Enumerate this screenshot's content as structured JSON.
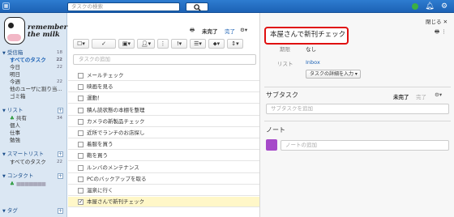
{
  "topbar": {
    "menu_icon": "grid-icon",
    "search_placeholder": "タスクの検索",
    "search_button_icon": "search-icon",
    "icons": [
      "check-circle-icon",
      "bell-icon",
      "gear-icon"
    ]
  },
  "sidebar": {
    "logo_line1": "remember",
    "logo_line2": "the milk",
    "inbox_header": "受信箱",
    "inbox_count": "18",
    "inbox_items": [
      {
        "label": "すべてのタスク",
        "count": "22",
        "active": true
      },
      {
        "label": "今日",
        "count": "22"
      },
      {
        "label": "明日",
        "count": ""
      },
      {
        "label": "今週",
        "count": "22"
      },
      {
        "label": "他のユーザに割り当...",
        "count": ""
      },
      {
        "label": "ゴミ箱",
        "count": ""
      }
    ],
    "lists_header": "リスト",
    "list_items": [
      {
        "label": "共有",
        "count": "34"
      },
      {
        "label": "個人",
        "count": ""
      },
      {
        "label": "仕事",
        "count": ""
      },
      {
        "label": "勉強",
        "count": ""
      }
    ],
    "smart_header": "スマートリスト",
    "smart_items": [
      {
        "label": "すべてのタスク",
        "count": "22"
      }
    ],
    "contacts_header": "コンタクト",
    "contact_name": "■■■■■■■",
    "tags_header": "タグ"
  },
  "tasklist": {
    "tab_incomplete": "未完了",
    "tab_complete": "完了",
    "add_placeholder": "タスクの追加",
    "tasks": [
      {
        "name": "メールチェック",
        "checked": false
      },
      {
        "name": "映画を見る",
        "checked": false
      },
      {
        "name": "運動！",
        "checked": false
      },
      {
        "name": "積ん読状態の本棚を整理",
        "checked": false
      },
      {
        "name": "カメラの新製品チェック",
        "checked": false
      },
      {
        "name": "近所でランチのお店探し",
        "checked": false
      },
      {
        "name": "着服を買う",
        "checked": false
      },
      {
        "name": "鞄を買う",
        "checked": false
      },
      {
        "name": "ルンバのメンテナンス",
        "checked": false
      },
      {
        "name": "PCのバックアップを取る",
        "checked": false
      },
      {
        "name": "温泉に行く",
        "checked": false
      },
      {
        "name": "本屋さんで新刊チェック",
        "checked": true
      }
    ]
  },
  "detail": {
    "close_label": "閉じる",
    "title": "本屋さんで新刊チェック",
    "due_label": "期限",
    "due_value": "なし",
    "list_label": "リスト",
    "list_value": "Inbox",
    "enter_details": "タスクの詳細を入力",
    "subtasks_header": "サブタスク",
    "sub_tab_incomplete": "未完了",
    "sub_tab_complete": "完了",
    "subtask_placeholder": "サブタスクを追加",
    "notes_header": "ノート",
    "note_placeholder": "ノートの追加"
  },
  "colors": {
    "topbar": "#1c62b5",
    "highlight": "#e01010",
    "accent": "#1c62b5"
  }
}
